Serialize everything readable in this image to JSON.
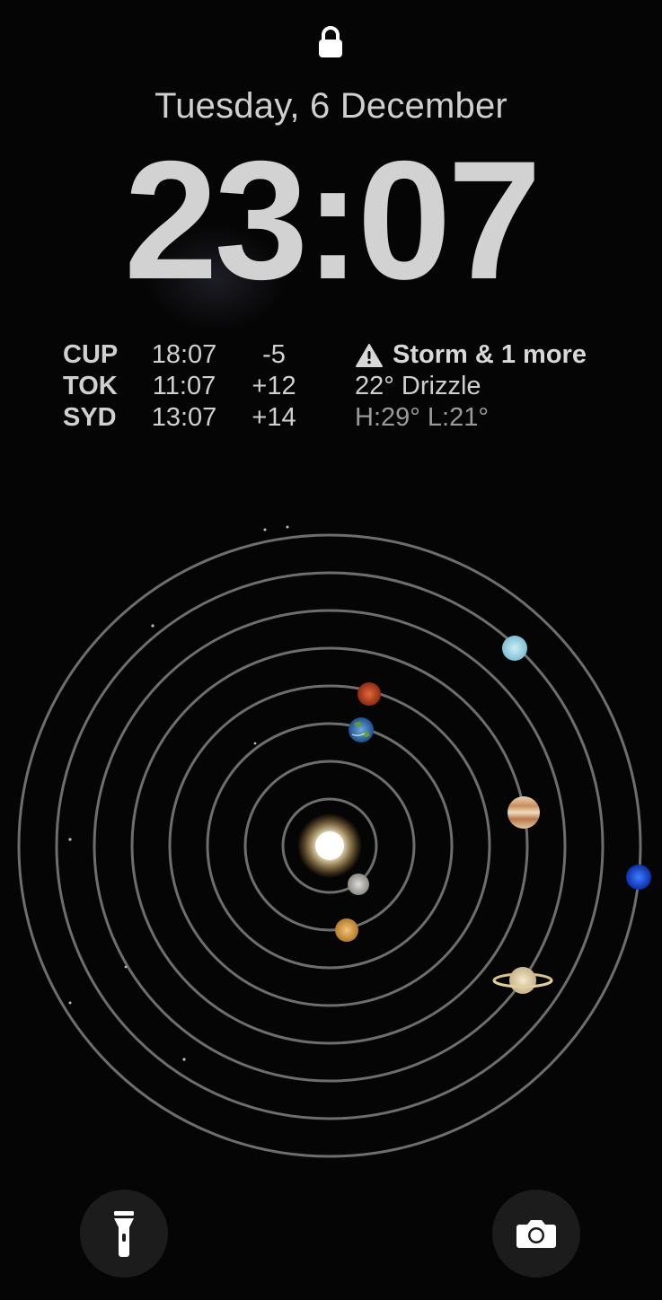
{
  "lock_screen": {
    "date": "Tuesday, 6 December",
    "time": "23:07",
    "lock_icon": "lock-icon"
  },
  "world_clock": [
    {
      "city": "CUP",
      "time": "18:07",
      "offset": "-5"
    },
    {
      "city": "TOK",
      "time": "11:07",
      "offset": "+12"
    },
    {
      "city": "SYD",
      "time": "13:07",
      "offset": "+14"
    }
  ],
  "weather": {
    "alert": "Storm & 1 more",
    "alert_icon": "warning-triangle-icon",
    "condition": "22° Drizzle",
    "high_low": "H:29° L:21°"
  },
  "wallpaper": {
    "type": "solar-system",
    "bodies": [
      "sun",
      "mercury",
      "venus",
      "earth",
      "mars",
      "jupiter",
      "saturn",
      "uranus",
      "neptune"
    ]
  },
  "actions": {
    "flashlight_icon": "flashlight-icon",
    "camera_icon": "camera-icon"
  },
  "colors": {
    "background": "#050505",
    "text": "#d2d2d2",
    "secondary_text": "#9a9a9a",
    "orbit": "#6e6e6e",
    "button": "#1c1c1c"
  }
}
